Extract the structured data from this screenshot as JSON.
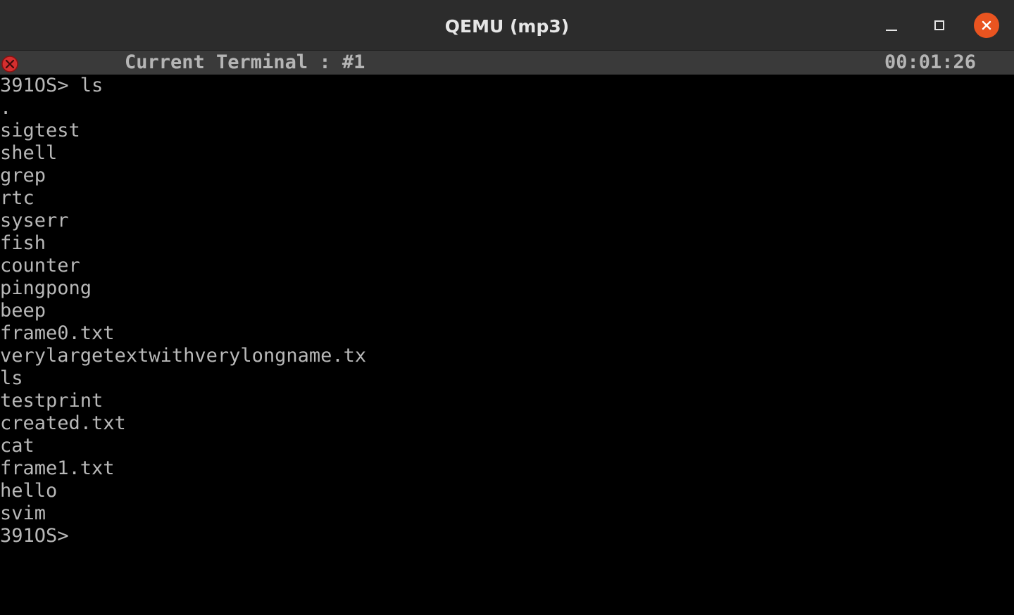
{
  "window": {
    "title": "QEMU (mp3)",
    "close_color": "#e95420"
  },
  "status": {
    "label": "Current Terminal : #1",
    "time": "00:01:26"
  },
  "terminal": {
    "lines": [
      "391OS> ls",
      ".",
      "sigtest",
      "shell",
      "grep",
      "rtc",
      "syserr",
      "fish",
      "counter",
      "pingpong",
      "beep",
      "frame0.txt",
      "verylargetextwithverylongname.tx",
      "ls",
      "testprint",
      "created.txt",
      "cat",
      "frame1.txt",
      "hello",
      "svim",
      "391OS>"
    ]
  }
}
